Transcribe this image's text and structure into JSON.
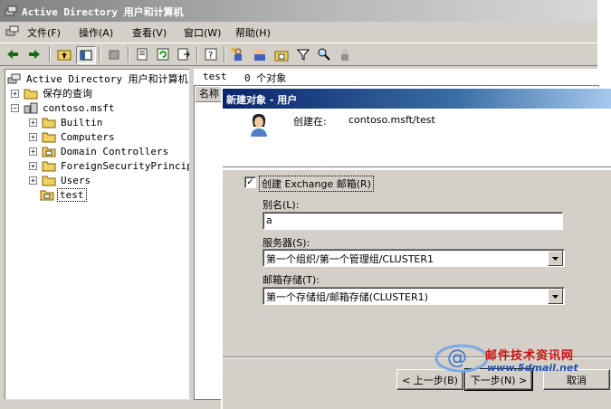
{
  "window": {
    "title": "Active Directory 用户和计算机"
  },
  "menu": [
    "文件(F)",
    "操作(A)",
    "查看(V)",
    "窗口(W)",
    "帮助(H)"
  ],
  "toolbar": {
    "icons": [
      "back-arrow-icon",
      "forward-arrow-icon",
      "up-folder-icon",
      "show-hide-tree-icon",
      "delete-icon",
      "properties-icon",
      "refresh-icon",
      "export-list-icon",
      "help-icon",
      "new-user-icon",
      "new-group-icon",
      "new-ou-icon",
      "filter-icon",
      "find-icon",
      "add-to-group-icon"
    ]
  },
  "tree": {
    "root": "Active Directory 用户和计算机",
    "saved_queries": "保存的查询",
    "domain": "contoso.msft",
    "children": [
      "Builtin",
      "Computers",
      "Domain Controllers",
      "ForeignSecurityPrincipal",
      "Users",
      "test"
    ],
    "selected": "test"
  },
  "right_pane": {
    "container": "test",
    "object_count": "0 个对象",
    "column_header": "名称"
  },
  "dialog": {
    "title": "新建对象 - 用户",
    "create_in_label": "创建在:",
    "create_in_path": "contoso.msft/test",
    "create_mailbox_label": "创建 Exchange 邮箱(R)",
    "create_mailbox_checked": true,
    "alias_label": "别名(L):",
    "alias_value": "a",
    "server_label": "服务器(S):",
    "server_value": "第一个组织/第一个管理组/CLUSTER1",
    "store_label": "邮箱存储(T):",
    "store_value": "第一个存储组/邮箱存储(CLUSTER1)",
    "back_button": "< 上一步(B)",
    "next_button": "下一步(N) >",
    "cancel_button": "取消"
  },
  "watermark": {
    "text": "邮件技术资讯网",
    "url": "www.5dmail.net"
  }
}
